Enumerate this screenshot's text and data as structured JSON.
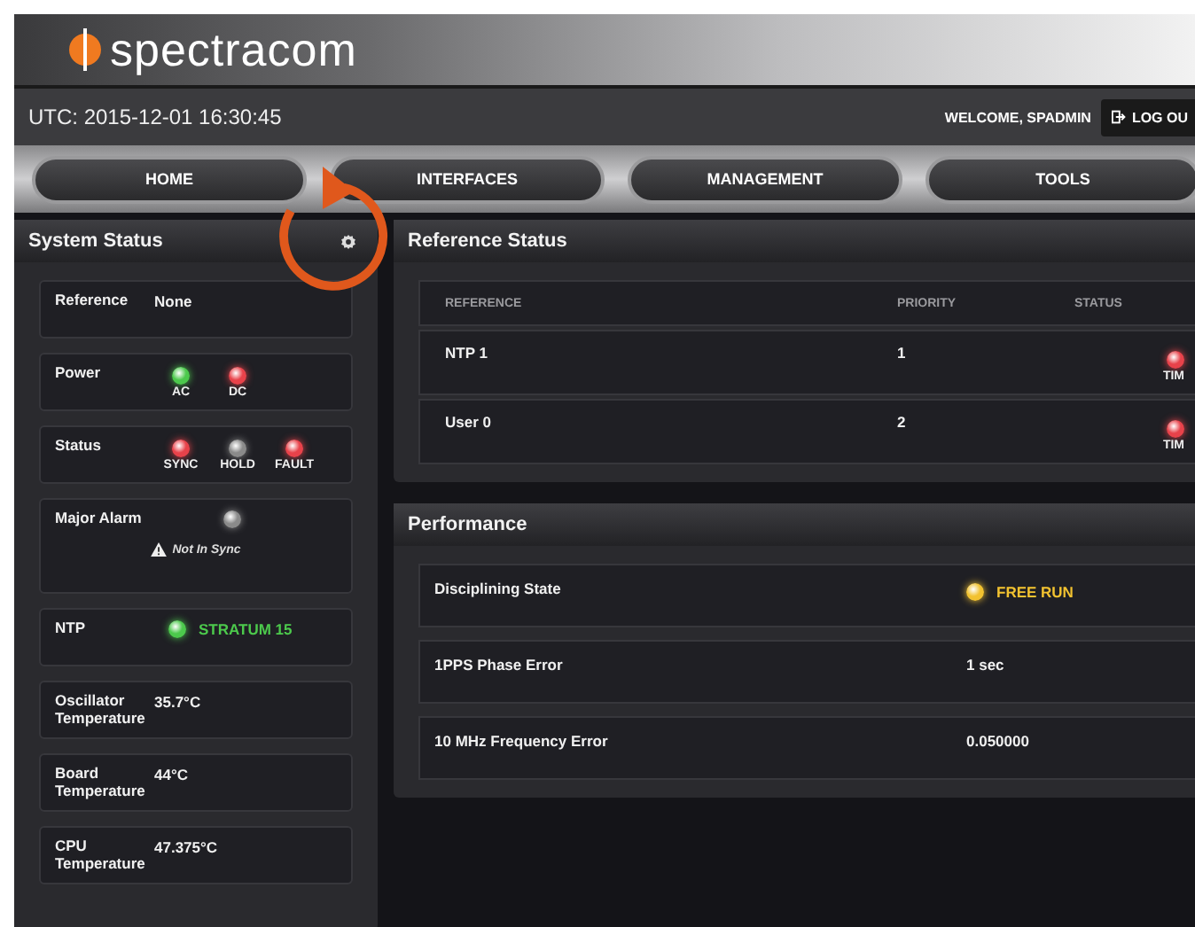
{
  "header": {
    "logo_text": "spectracom"
  },
  "top_bar": {
    "utc": "UTC: 2015-12-01 16:30:45",
    "welcome": "WELCOME, SPADMIN",
    "logout": "LOG OU"
  },
  "nav": [
    {
      "label": "HOME"
    },
    {
      "label": "INTERFACES"
    },
    {
      "label": "MANAGEMENT"
    },
    {
      "label": "TOOLS"
    }
  ],
  "system_status": {
    "title": "System Status",
    "cards": [
      {
        "kind": "text",
        "label": "Reference",
        "value": "None"
      },
      {
        "kind": "lamps",
        "label": "Power",
        "lamps": [
          {
            "label": "AC",
            "color": "#4cc94c"
          },
          {
            "label": "DC",
            "color": "#e8424a"
          }
        ]
      },
      {
        "kind": "lamps",
        "label": "Status",
        "lamps": [
          {
            "label": "SYNC",
            "color": "#e8424a"
          },
          {
            "label": "HOLD",
            "color": "#8a8a8a"
          },
          {
            "label": "FAULT",
            "color": "#e8424a"
          }
        ]
      },
      {
        "kind": "alarm",
        "label": "Major Alarm",
        "color": "#8a8a8a",
        "message": "Not In Sync"
      },
      {
        "kind": "lamp_value",
        "label": "NTP",
        "color": "#4cc94c",
        "value": "STRATUM 15"
      },
      {
        "kind": "text",
        "label": "Oscillator Temperature",
        "value": "35.7°C"
      },
      {
        "kind": "text",
        "label": "Board Temperature",
        "value": "44°C"
      },
      {
        "kind": "text",
        "label": "CPU Temperature",
        "value": "47.375°C"
      }
    ]
  },
  "reference_status": {
    "title": "Reference Status",
    "columns": [
      "REFERENCE",
      "PRIORITY",
      "STATUS"
    ],
    "rows": [
      {
        "reference": "NTP 1",
        "priority": "1",
        "status": "TIM",
        "color": "#e8424a"
      },
      {
        "reference": "User 0",
        "priority": "2",
        "status": "TIM",
        "color": "#e8424a"
      }
    ]
  },
  "performance": {
    "title": "Performance",
    "rows": [
      {
        "kind": "lamp",
        "label": "Disciplining State",
        "value": "FREE RUN",
        "color": "#f2c230"
      },
      {
        "kind": "text",
        "label": "1PPS Phase Error",
        "value": "1 sec"
      },
      {
        "kind": "text",
        "label": "10 MHz Frequency Error",
        "value": "0.050000"
      }
    ]
  }
}
